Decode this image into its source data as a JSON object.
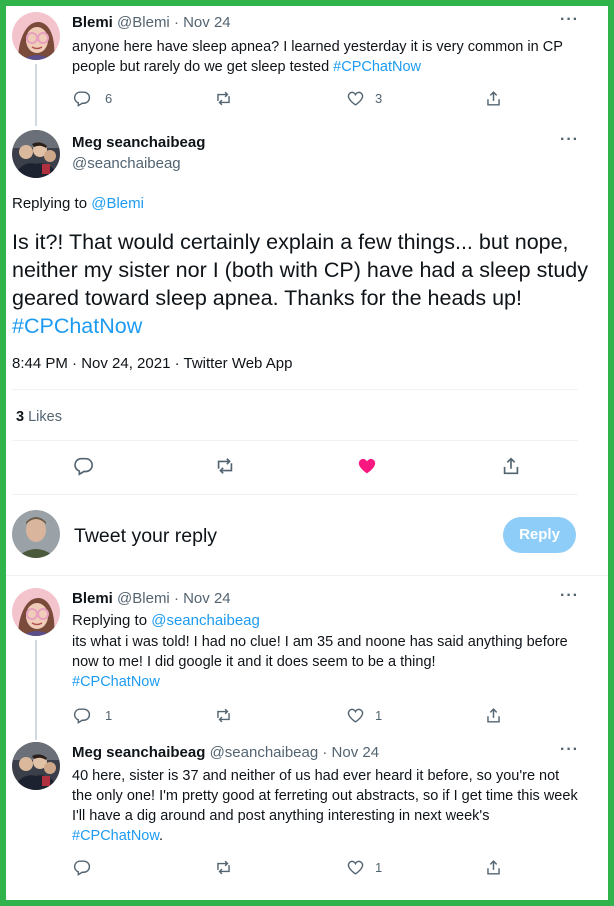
{
  "tweet1": {
    "name": "Blemi",
    "handle": "@Blemi",
    "date": "· Nov 24",
    "more": "···",
    "text_plain": "anyone here have sleep apnea? I learned yesterday it is very common in CP people but rarely do we get sleep tested ",
    "hashtag": "#CPChatNow",
    "replies": "6",
    "likes": "3"
  },
  "main": {
    "name": "Meg seanchaibeag",
    "handle": "@seanchaibeag",
    "more": "···",
    "replying_prefix": "Replying to ",
    "replying_handle": "@Blemi",
    "text_plain": "Is it?! That would certainly explain a few things... but nope, neither my sister nor I (both with CP) have had a sleep study geared toward sleep apnea. Thanks for the heads up! ",
    "hashtag": "#CPChatNow",
    "meta": "8:44 PM · Nov 24, 2021 · Twitter Web App",
    "likes_count": "3",
    "likes_label": " Likes",
    "liked_color": "#f91880"
  },
  "reply_box": {
    "placeholder": "Tweet your reply",
    "button": "Reply"
  },
  "tweet3": {
    "name": "Blemi",
    "handle": "@Blemi",
    "date": "· Nov 24",
    "more": "···",
    "replying_prefix": "Replying to ",
    "replying_handle": "@seanchaibeag",
    "text_plain": "its what i was told! I had no clue! I am 35 and noone has said anything before now to me! I did google it and it does seem to be a thing!",
    "hashtag": "#CPChatNow",
    "replies": "1",
    "likes": "1"
  },
  "tweet4": {
    "name": "Meg seanchaibeag",
    "handle": "@seanchaibeag",
    "date": "· Nov 24",
    "more": "···",
    "text_plain": "40 here, sister is 37 and neither of us had ever heard it before, so you're not the only one! I'm pretty good at ferreting out abstracts, so if I get time this week I'll have a dig around and post anything interesting in next week's ",
    "hashtag": "#CPChatNow",
    "text_end": ".",
    "likes": "1"
  },
  "colors": {
    "accent": "#1d9bf0",
    "border": "#2fb34a",
    "like": "#f91880"
  }
}
